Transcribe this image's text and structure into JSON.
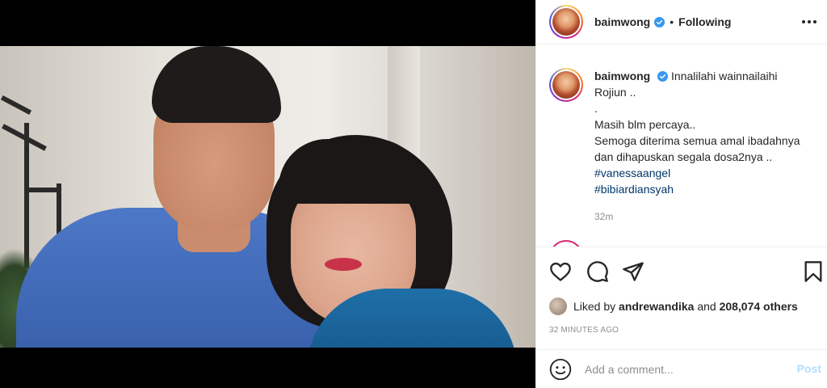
{
  "post": {
    "username": "baimwong",
    "follow_status": "Following",
    "separator": "•",
    "caption": {
      "username": "baimwong",
      "lines": [
        "Innalilahi wainnailaihi",
        "Rojiun ..",
        ".",
        "Masih blm percaya..",
        "Semoga diterima semua amal ibadahnya",
        "dan dihapuskan segala dosa2nya .."
      ],
      "hashtags": [
        "#vanessaangel",
        "#bibiardiansyah"
      ],
      "time": "32m"
    },
    "likes": {
      "prefix": "Liked by",
      "user": "andrewandika",
      "conjunction": "and",
      "count": "208,074 others"
    },
    "posted_ago": "32 MINUTES AGO",
    "comment": {
      "placeholder": "Add a comment...",
      "post_label": "Post"
    }
  },
  "icons": {
    "verified": "verified-badge-icon",
    "more": "more-options-icon",
    "like": "heart-icon",
    "comment": "comment-icon",
    "share": "paper-plane-icon",
    "save": "bookmark-icon",
    "emoji": "emoji-icon"
  },
  "colors": {
    "verified": "#3897f0",
    "link": "#00376b",
    "post_disabled": "#b2dffc",
    "muted": "#8e8e8e"
  }
}
